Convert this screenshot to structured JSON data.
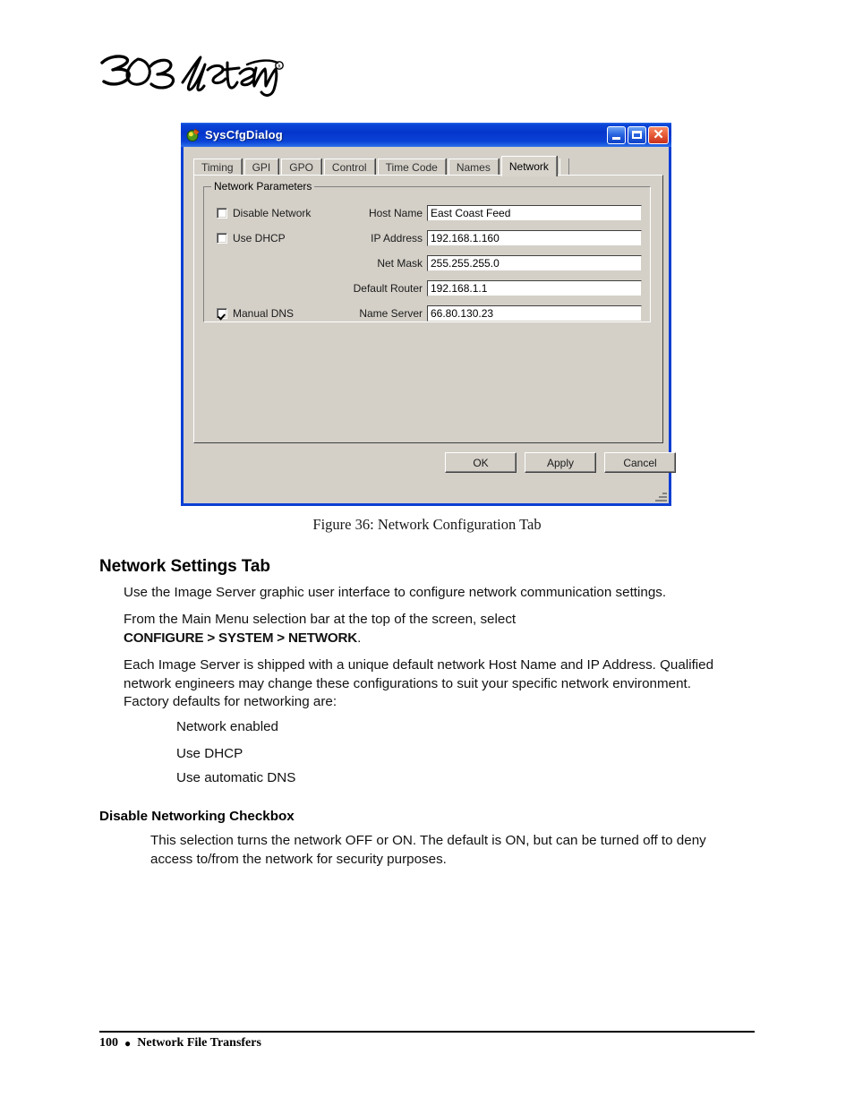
{
  "page": {
    "logo_alt": "360 Systems",
    "footer": {
      "page_number": "100",
      "separator": "●",
      "section": "Network File Transfers"
    }
  },
  "dialog": {
    "title": "SysCfgDialog",
    "icon": "app-icon",
    "window_buttons": {
      "minimize": "_",
      "maximize": "□",
      "close": "✕"
    },
    "tabs": [
      {
        "label": "Timing",
        "active": false
      },
      {
        "label": "GPI",
        "active": false
      },
      {
        "label": "GPO",
        "active": false
      },
      {
        "label": "Control",
        "active": false
      },
      {
        "label": "Time Code",
        "active": false
      },
      {
        "label": "Names",
        "active": false
      },
      {
        "label": "Network",
        "active": true
      }
    ],
    "group": {
      "legend": "Network Parameters",
      "checkboxes": [
        {
          "label": "Disable Network",
          "checked": false
        },
        {
          "label": "Use DHCP",
          "checked": false
        },
        {
          "label": "Manual DNS",
          "checked": true
        }
      ],
      "fields": [
        {
          "label": "Host Name",
          "value": "East Coast Feed"
        },
        {
          "label": "IP Address",
          "value": "192.168.1.160"
        },
        {
          "label": "Net Mask",
          "value": "255.255.255.0"
        },
        {
          "label": "Default Router",
          "value": "192.168.1.1"
        },
        {
          "label": "Name Server",
          "value": "66.80.130.23"
        }
      ]
    },
    "buttons": [
      {
        "label": "OK"
      },
      {
        "label": "Apply"
      },
      {
        "label": "Cancel"
      }
    ]
  },
  "figure": {
    "caption": "Figure 36: Network Configuration Tab"
  },
  "content": {
    "heading": "Network Settings Tab",
    "paragraph1": "Use the Image Server graphic user interface to configure network communication settings.",
    "paragraph2_line1": "From the Main Menu selection bar at the top of the screen, select",
    "paragraph2_line2_bold": "CONFIGURE > SYSTEM > NETWORK",
    "paragraph2_line2_tail": ".",
    "paragraph3": "Each Image Server is shipped with a unique default network Host Name and IP Address. Qualified network engineers may change these configurations to suit your specific network environment.  Factory defaults for networking are:",
    "defaults": [
      "Network enabled",
      "Use DHCP",
      "Use automatic DNS"
    ],
    "subheading": "Disable Networking Checkbox",
    "paragraph4": "This selection turns the network OFF or ON.  The default is ON, but can be turned off to deny access to/from the network for security purposes."
  },
  "colors": {
    "titlebar_blue": "#0b3fd4",
    "dialog_face": "#d4d0c8",
    "close_red": "#c8301c"
  }
}
